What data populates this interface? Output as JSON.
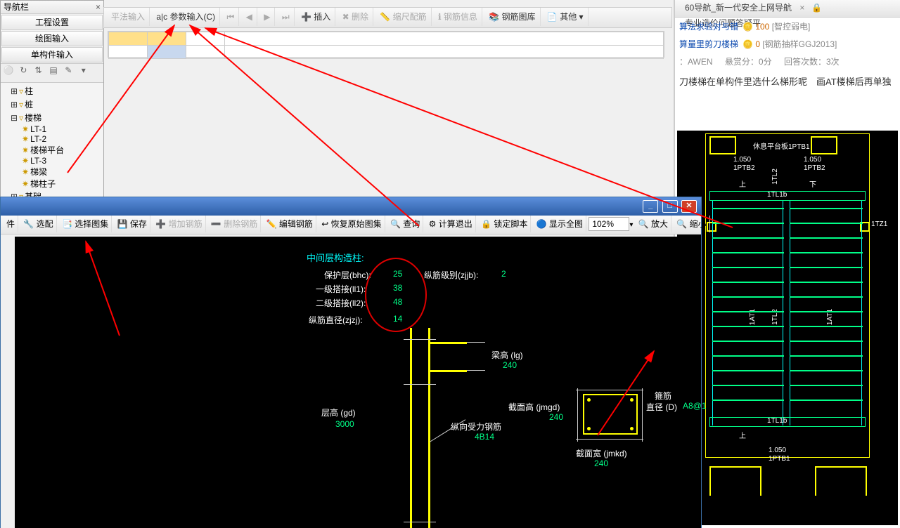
{
  "nav": {
    "title": "导航栏",
    "btn_project": "工程设置",
    "btn_draw": "绘图输入",
    "btn_single": "单构件输入",
    "tree": {
      "zhu": "柱",
      "zhuang": "桩",
      "louti": "楼梯",
      "lt1": "LT-1",
      "lt2": "LT-2",
      "ltpt": "楼梯平台",
      "lt3": "LT-3",
      "tiliang": "梯梁",
      "tizhuzi": "梯柱子",
      "jichu": "基础"
    }
  },
  "tb_upper": {
    "ping": "平法输入",
    "param": "参数输入(C)",
    "nav_first": "⏮",
    "nav_prev": "◀",
    "nav_next": "▶",
    "nav_last": "⏭",
    "insert": "插入",
    "delete": "删除",
    "scale": "缩尺配筋",
    "info": "钢筋信息",
    "lib": "钢筋图库",
    "other": "其他 ▾"
  },
  "rp": {
    "tab1": "60导航_新一代安全上网导航",
    "tab2": "专业造价问题答疑平",
    "link1": {
      "text": "算法求验对与错",
      "coin": "100",
      "tag": "[智控弱电]"
    },
    "link2": {
      "text": "算量里剪刀楼梯",
      "coin": "0",
      "tag": "[钢筋抽样GGJ2013]"
    },
    "meta_user": "：AWEN",
    "meta_bounty": "悬赏分：0分",
    "meta_answers": "回答次数：3次",
    "question": "刀楼梯在单构件里选什么梯形呢　画AT楼梯后再单独",
    "stair": {
      "top_lbl": "休息平台板1PTB1",
      "lbl_1050a": "1.050",
      "lbl_1ptb2a": "1PTB2",
      "lbl_1050b": "1.050",
      "lbl_1ptb2b": "1PTB2",
      "up": "上",
      "down": "下",
      "tl1b": "1TL1b",
      "tz1a": "1TZ1",
      "tz1b": "1TZ1",
      "at1a": "1AT1",
      "at1b": "1AT1",
      "tl1b2": "1TL1b",
      "up2": "上",
      "lbl_1050c": "1.050",
      "lbl_1ptb1": "1PTB1",
      "tl2": "1TL2",
      "tl2b": "1TL2"
    }
  },
  "sub": {
    "tb": {
      "jian": "件",
      "xuanpei": "选配",
      "xuanze": "选择图集",
      "save": "保存",
      "addbar": "增加钢筋",
      "delbar": "删除钢筋",
      "editbar": "编辑钢筋",
      "restore": "恢复原始图集",
      "query": "查询",
      "calcexit": "计算退出",
      "lock": "锁定脚本",
      "showall": "显示全图",
      "zoom": "102%",
      "zoomin": "放大",
      "zoomout": "缩小"
    },
    "cad": {
      "heading": "中间层构造柱:",
      "r1k": "保护层(bhc):",
      "r1v": "25",
      "r2k": "一级搭接(ll1):",
      "r2v": "38",
      "r3k": "二级搭接(ll2):",
      "r3v": "48",
      "r4k": "纵筋直径(zjzj):",
      "r4v": "14",
      "zjjb_k": "纵筋级别(zjjb):",
      "zjjb_v": "2",
      "lg_k": "梁高 (lg)",
      "lg_v": "240",
      "gd_k": "层高 (gd)",
      "gd_v": "3000",
      "zxsl": "纵向受力钢筋",
      "zxsl_v": "4B14",
      "jmgd_k": "截面高 (jmgd)",
      "jmgd_v": "240",
      "jmkd_k": "截面宽 (jmkd)",
      "jmkd_v": "240",
      "guj_k": "箍筋",
      "guj_k2": "直径 (D)",
      "guj_v": "A8@1"
    }
  }
}
